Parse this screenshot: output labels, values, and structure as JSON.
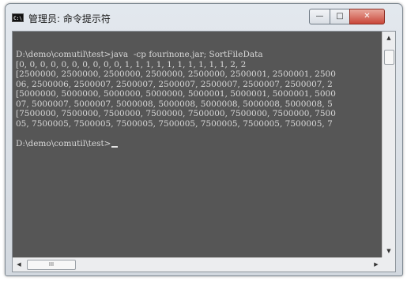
{
  "window": {
    "title": "管理员: 命令提示符",
    "icon_text": "C:\\",
    "controls": {
      "minimize": "—",
      "maximize": "□",
      "close": "✕"
    }
  },
  "console": {
    "lines": [
      "D:\\demo\\comutil\\test>java  -cp fourinone.jar; SortFileData",
      "[0, 0, 0, 0, 0, 0, 0, 0, 0, 0, 1, 1, 1, 1, 1, 1, 1, 1, 1, 1, 2, 2",
      "[2500000, 2500000, 2500000, 2500000, 2500000, 2500001, 2500001, 2500",
      "06, 2500006, 2500007, 2500007, 2500007, 2500007, 2500007, 2500007, 2",
      "[5000000, 5000000, 5000000, 5000000, 5000001, 5000001, 5000001, 5000",
      "07, 5000007, 5000007, 5000008, 5000008, 5000008, 5000008, 5000008, 5",
      "[7500000, 7500000, 7500000, 7500000, 7500000, 7500000, 7500000, 7500",
      "05, 7500005, 7500005, 7500005, 7500005, 7500005, 7500005, 7500005, 7",
      "",
      "D:\\demo\\comutil\\test>"
    ]
  },
  "scrollbars": {
    "vertical": {
      "up": "▲",
      "down": "▼"
    },
    "horizontal": {
      "left": "◀",
      "right": "▶",
      "thumb_grip": "III"
    }
  }
}
